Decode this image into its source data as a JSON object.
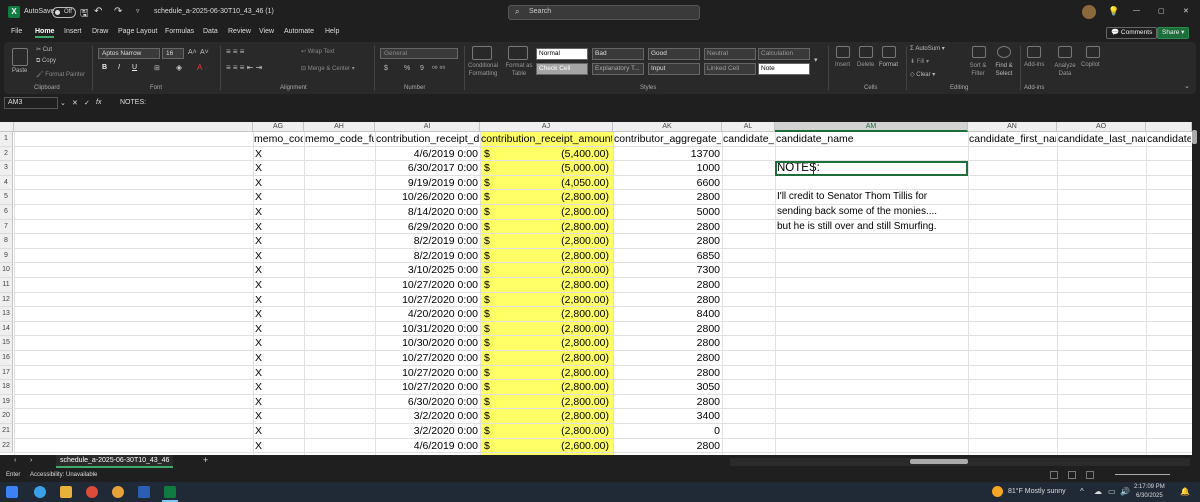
{
  "titlebar": {
    "autosave_label": "AutoSave",
    "autosave_state": "Off",
    "file_name": "schedule_a-2025-06-30T10_43_46 (1)",
    "search_placeholder": "Search",
    "window_controls": [
      "—",
      "▢",
      "✕"
    ]
  },
  "ribbon_tabs": [
    "File",
    "Home",
    "Insert",
    "Draw",
    "Page Layout",
    "Formulas",
    "Data",
    "Review",
    "View",
    "Automate",
    "Help"
  ],
  "active_tab": "Home",
  "ribbon_buttons": {
    "comments": "Comments",
    "share": "Share"
  },
  "clipboard": {
    "paste": "Paste",
    "cut": "Cut",
    "copy": "Copy",
    "format_painter": "Format Painter",
    "label": "Clipboard"
  },
  "font": {
    "family": "Aptos Narrow",
    "size": "16",
    "bold": "B",
    "italic": "I",
    "underline": "U",
    "label": "Font"
  },
  "alignment": {
    "wrap_text": "Wrap Text",
    "merge_center": "Merge & Center",
    "label": "Alignment"
  },
  "number": {
    "format": "General",
    "currency": "$",
    "percent": "%",
    "comma": "9",
    "label": "Number"
  },
  "styles": {
    "conditional": "Conditional Formatting",
    "format_as_table": "Format as Table",
    "cells": [
      {
        "name": "Normal",
        "bg": "#ffffff",
        "fg": "#000000"
      },
      {
        "name": "Bad",
        "bg": "#3a3a3a",
        "fg": "#dddddd"
      },
      {
        "name": "Good",
        "bg": "#3a3a3a",
        "fg": "#dddddd"
      },
      {
        "name": "Neutral",
        "bg": "#3a3a3a",
        "fg": "#999999"
      },
      {
        "name": "Calculation",
        "bg": "#3a3a3a",
        "fg": "#999999"
      },
      {
        "name": "Check Cell",
        "bg": "#a5a5a5",
        "fg": "#ffffff"
      },
      {
        "name": "Explanatory T...",
        "bg": "#3a3a3a",
        "fg": "#aaaaaa"
      },
      {
        "name": "Input",
        "bg": "#3a3a3a",
        "fg": "#dddddd"
      },
      {
        "name": "Linked Cell",
        "bg": "#3a3a3a",
        "fg": "#999999"
      },
      {
        "name": "Note",
        "bg": "#ffffff",
        "fg": "#000000"
      }
    ],
    "label": "Styles"
  },
  "cells_group": {
    "insert": "Insert",
    "delete": "Delete",
    "format": "Format",
    "label": "Cells"
  },
  "editing": {
    "autosum": "AutoSum",
    "fill": "Fill",
    "clear": "Clear",
    "sort_filter": "Sort & Filter",
    "find_select": "Find & Select",
    "label": "Editing"
  },
  "addins": {
    "addins": "Add-ins",
    "analyze": "Analyze Data",
    "copilot": "Copilot",
    "label": "Add-ins"
  },
  "formula_bar": {
    "name_box": "AM3",
    "fx": "fx",
    "content": "NOTES:"
  },
  "columns": [
    "AG",
    "AH",
    "AI",
    "AJ",
    "AK",
    "AL",
    "AM",
    "AN",
    "AO"
  ],
  "header_row": [
    "memo_code",
    "memo_code_fu",
    "contribution_receipt_da",
    "contribution_receipt_amount",
    "contributor_aggregate_y",
    "candidate_i",
    "candidate_name",
    "candidate_first_nam",
    "candidate_last_nam",
    "candidate"
  ],
  "rows": [
    {
      "n": "1"
    },
    {
      "n": "2",
      "memo": "X",
      "date": "4/6/2019 0:00",
      "cur": "$",
      "amount": "(5,400.00)",
      "agg": "13700"
    },
    {
      "n": "3",
      "memo": "X",
      "date": "6/30/2017 0:00",
      "cur": "$",
      "amount": "(5,000.00)",
      "agg": "1000",
      "note": "NOTES:"
    },
    {
      "n": "4",
      "memo": "X",
      "date": "9/19/2019 0:00",
      "cur": "$",
      "amount": "(4,050.00)",
      "agg": "6600"
    },
    {
      "n": "5",
      "memo": "X",
      "date": "10/26/2020 0:00",
      "cur": "$",
      "amount": "(2,800.00)",
      "agg": "2800",
      "note": "I'll credit to Senator Thom Tillis for"
    },
    {
      "n": "6",
      "memo": "X",
      "date": "8/14/2020 0:00",
      "cur": "$",
      "amount": "(2,800.00)",
      "agg": "5000",
      "note": "sending back some of the monies...."
    },
    {
      "n": "7",
      "memo": "X",
      "date": "6/29/2020 0:00",
      "cur": "$",
      "amount": "(2,800.00)",
      "agg": "2800",
      "note": "but he is still over and still Smurfing."
    },
    {
      "n": "8",
      "memo": "X",
      "date": "8/2/2019 0:00",
      "cur": "$",
      "amount": "(2,800.00)",
      "agg": "2800"
    },
    {
      "n": "9",
      "memo": "X",
      "date": "8/2/2019 0:00",
      "cur": "$",
      "amount": "(2,800.00)",
      "agg": "6850"
    },
    {
      "n": "10",
      "memo": "X",
      "date": "3/10/2025 0:00",
      "cur": "$",
      "amount": "(2,800.00)",
      "agg": "7300"
    },
    {
      "n": "11",
      "memo": "X",
      "date": "10/27/2020 0:00",
      "cur": "$",
      "amount": "(2,800.00)",
      "agg": "2800"
    },
    {
      "n": "12",
      "memo": "X",
      "date": "10/27/2020 0:00",
      "cur": "$",
      "amount": "(2,800.00)",
      "agg": "2800"
    },
    {
      "n": "13",
      "memo": "X",
      "date": "4/20/2020 0:00",
      "cur": "$",
      "amount": "(2,800.00)",
      "agg": "8400"
    },
    {
      "n": "14",
      "memo": "X",
      "date": "10/31/2020 0:00",
      "cur": "$",
      "amount": "(2,800.00)",
      "agg": "2800"
    },
    {
      "n": "15",
      "memo": "X",
      "date": "10/30/2020 0:00",
      "cur": "$",
      "amount": "(2,800.00)",
      "agg": "2800"
    },
    {
      "n": "16",
      "memo": "X",
      "date": "10/27/2020 0:00",
      "cur": "$",
      "amount": "(2,800.00)",
      "agg": "2800"
    },
    {
      "n": "17",
      "memo": "X",
      "date": "10/27/2020 0:00",
      "cur": "$",
      "amount": "(2,800.00)",
      "agg": "2800"
    },
    {
      "n": "18",
      "memo": "X",
      "date": "10/27/2020 0:00",
      "cur": "$",
      "amount": "(2,800.00)",
      "agg": "3050"
    },
    {
      "n": "19",
      "memo": "X",
      "date": "6/30/2020 0:00",
      "cur": "$",
      "amount": "(2,800.00)",
      "agg": "2800"
    },
    {
      "n": "20",
      "memo": "X",
      "date": "3/2/2020 0:00",
      "cur": "$",
      "amount": "(2,800.00)",
      "agg": "3400"
    },
    {
      "n": "21",
      "memo": "X",
      "date": "3/2/2020 0:00",
      "cur": "$",
      "amount": "(2,800.00)",
      "agg": "0"
    },
    {
      "n": "22",
      "memo": "X",
      "date": "4/6/2019 0:00",
      "cur": "$",
      "amount": "(2,600.00)",
      "agg": "2800"
    }
  ],
  "sheet_tab": "schedule_a-2025-06-30T10_43_46",
  "add_sheet": "+",
  "status": {
    "mode": "Enter",
    "accessibility": "Accessibility: Unavailable"
  },
  "taskbar": {
    "weather": "81°F  Mostly sunny",
    "time": "2:17:09 PM",
    "date": "6/30/2025"
  },
  "colors": {
    "accent": "#107c41",
    "highlight": "#ffff66",
    "selection": "#1e6e3c"
  }
}
